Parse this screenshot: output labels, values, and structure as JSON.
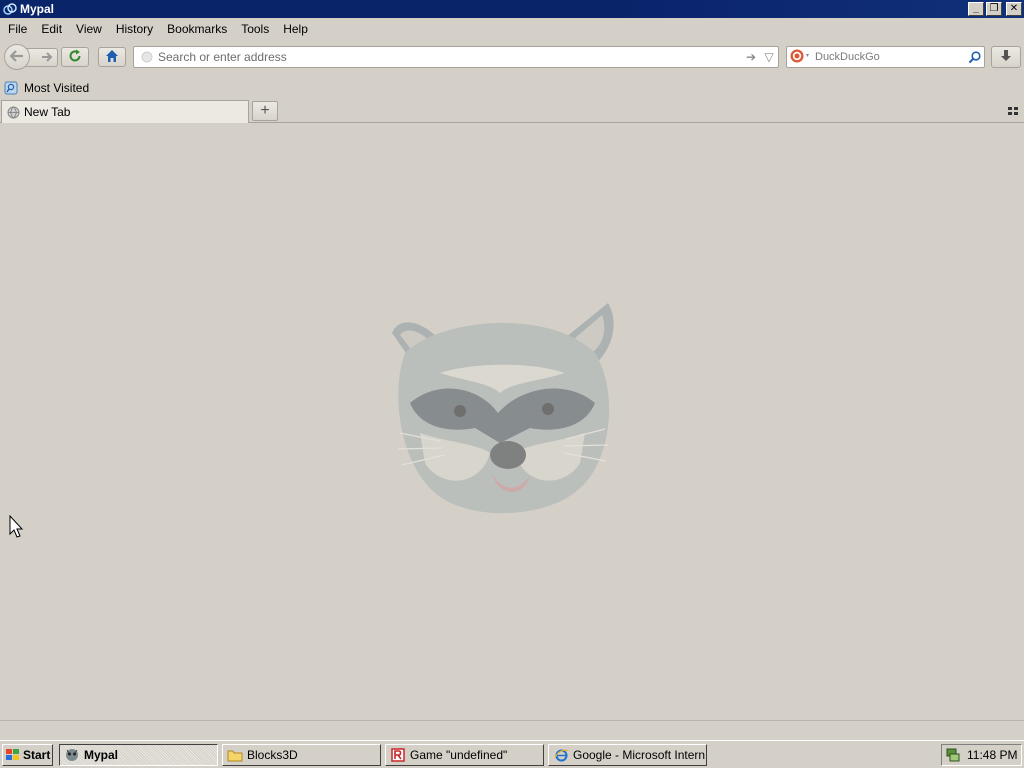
{
  "window": {
    "title": "Mypal",
    "buttons": {
      "minimize": "_",
      "restore": "❐",
      "close": "✕"
    }
  },
  "menu": [
    {
      "label": "File"
    },
    {
      "label": "Edit"
    },
    {
      "label": "View"
    },
    {
      "label": "History"
    },
    {
      "label": "Bookmarks"
    },
    {
      "label": "Tools"
    },
    {
      "label": "Help"
    }
  ],
  "navbar": {
    "url_placeholder": "Search or enter address",
    "url_value": "",
    "search_engine": "DuckDuckGo",
    "search_placeholder": "DuckDuckGo"
  },
  "bookmarks": {
    "most_visited": "Most Visited"
  },
  "tabs": {
    "active_label": "New Tab",
    "new_tab": "+"
  },
  "taskbar": {
    "start_label": "Start",
    "tasks": [
      {
        "label": "Mypal",
        "icon": "mypal-icon",
        "active": true
      },
      {
        "label": "Blocks3D",
        "icon": "folder-icon",
        "active": false
      },
      {
        "label": "Game \"undefined\"",
        "icon": "roblox-icon",
        "active": false
      },
      {
        "label": "Google - Microsoft Intern...",
        "icon": "ie-icon",
        "active": false
      }
    ],
    "clock": "11:48 PM"
  },
  "colors": {
    "titlebar": "#0a246a",
    "face": "#d4d0c8",
    "search_engine_accent": "#de5833"
  }
}
